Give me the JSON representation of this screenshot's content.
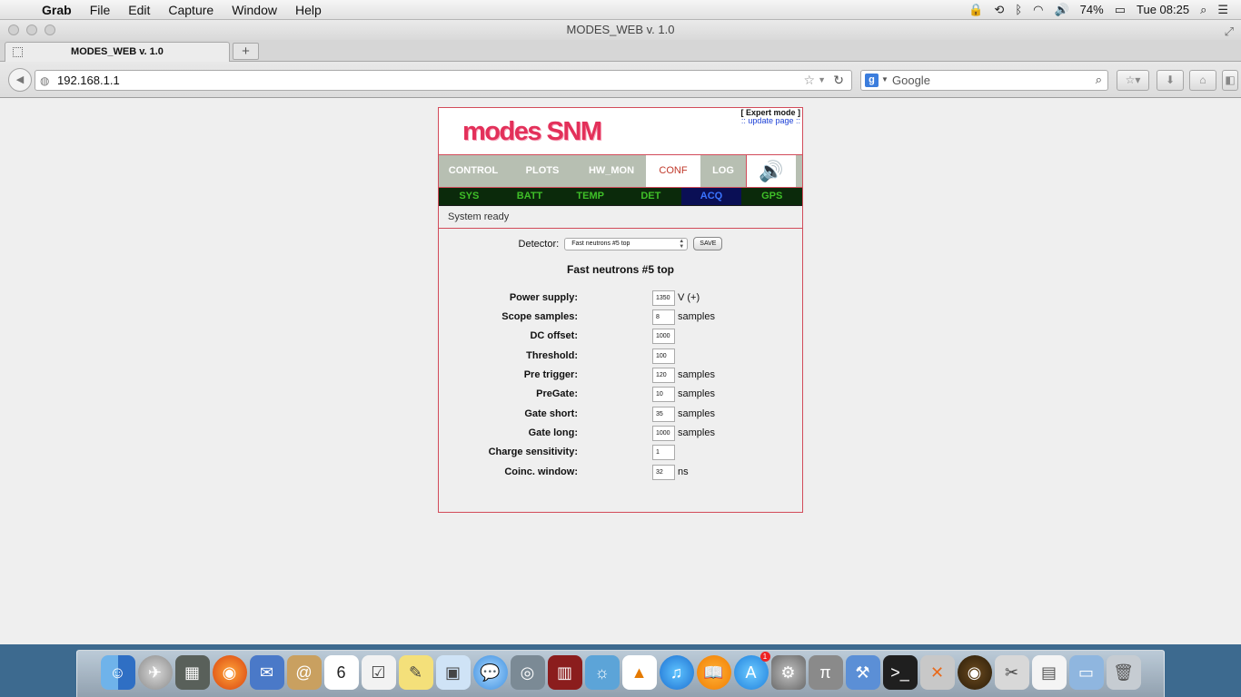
{
  "menubar": {
    "app": "Grab",
    "items": [
      "File",
      "Edit",
      "Capture",
      "Window",
      "Help"
    ],
    "battery": "74%",
    "clock": "Tue 08:25"
  },
  "browser": {
    "window_title": "MODES_WEB v. 1.0",
    "tab_title": "MODES_WEB v. 1.0",
    "new_tab": "+",
    "url": "192.168.1.1",
    "search_placeholder": "Google"
  },
  "page": {
    "logo": "modes SNM",
    "expert_mode": "[ Expert mode ]",
    "update_prefix": ":: ",
    "update_link": "update page",
    "update_suffix": " ::",
    "main_tabs": [
      "CONTROL",
      "PLOTS",
      "HW_MON",
      "CONF",
      "LOG"
    ],
    "active_main_tab": "CONF",
    "sub_tabs": [
      "SYS",
      "BATT",
      "TEMP",
      "DET",
      "ACQ",
      "GPS"
    ],
    "active_sub_tab": "ACQ",
    "status": "System ready",
    "detector_label": "Detector:",
    "detector_selected": "Fast neutrons #5 top",
    "save_label": "SAVE",
    "detector_title": "Fast neutrons #5 top",
    "params": [
      {
        "label": "Power supply:",
        "value": "1350",
        "unit": "V (+)"
      },
      {
        "label": "Scope samples:",
        "value": "8",
        "unit": "samples"
      },
      {
        "label": "DC offset:",
        "value": "1000",
        "unit": ""
      },
      {
        "label": "Threshold:",
        "value": "100",
        "unit": ""
      },
      {
        "label": "Pre trigger:",
        "value": "120",
        "unit": "samples"
      },
      {
        "label": "PreGate:",
        "value": "10",
        "unit": "samples"
      },
      {
        "label": "Gate short:",
        "value": "35",
        "unit": "samples"
      },
      {
        "label": "Gate long:",
        "value": "1000",
        "unit": "samples"
      },
      {
        "label": "Charge sensitivity:",
        "value": "1",
        "unit": ""
      },
      {
        "label": "Coinc. window:",
        "value": "32",
        "unit": "ns"
      }
    ]
  },
  "dock": {
    "apps": [
      "finder-icon",
      "launchpad-icon",
      "photo-icon",
      "firefox-icon",
      "mail-icon",
      "contacts-icon",
      "calendar-icon",
      "reminders-icon",
      "notes-icon",
      "preview-icon",
      "messages-icon",
      "facetime-icon",
      "photobooth-icon",
      "iphoto-icon",
      "vlc-icon",
      "itunes-icon",
      "ibooks-icon",
      "appstore-icon",
      "sysprefs-icon",
      "latex-icon",
      "xcode-icon",
      "terminal-icon",
      "x11-icon",
      "dvd-icon",
      "grab-icon",
      "document-icon",
      "folder-icon",
      "trash-icon"
    ],
    "calendar_day": "6",
    "appstore_badge": "1"
  }
}
